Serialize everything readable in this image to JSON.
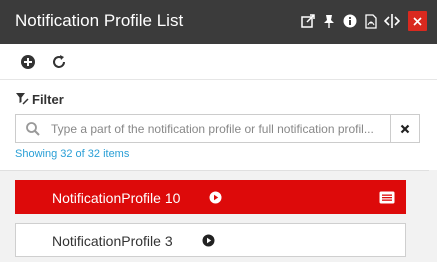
{
  "window": {
    "title": "Notification Profile List",
    "close_symbol": "×",
    "title_icons": [
      "external-link-icon",
      "pin-icon",
      "info-icon",
      "pdf-icon",
      "resize-horizontal-icon"
    ],
    "colors": {
      "titlebar": "#3b3b3b",
      "close": "#d9291f"
    }
  },
  "toolbar": {
    "buttons": [
      "add-circle-icon",
      "refresh-icon"
    ]
  },
  "filter": {
    "label": "Filter",
    "placeholder": "Type a part of the notification profile or full notification profil...",
    "value": "",
    "count_text": "Showing 32 of 32 items",
    "count_color": "#2a9fd6"
  },
  "list": {
    "items": [
      {
        "label": "NotificationProfile 10",
        "selected": true
      },
      {
        "label": "NotificationProfile 3",
        "selected": false
      }
    ],
    "selected_color": "#dd0a0a"
  }
}
